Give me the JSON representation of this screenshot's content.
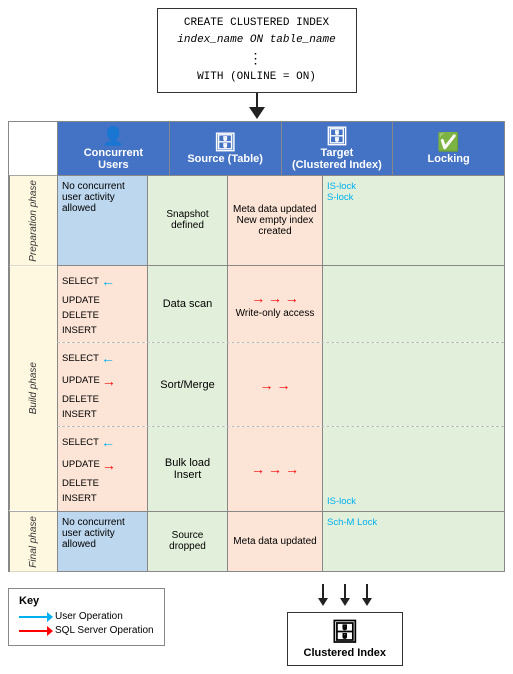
{
  "top": {
    "line1": "CREATE CLUSTERED INDEX",
    "line2": "index_name ON table_name",
    "dots": "⋮",
    "line3": "WITH (ONLINE = ON)"
  },
  "headers": {
    "concurrent": "Concurrent\nUsers",
    "source": "Source (Table)",
    "target": "Target\n(Clustered Index)",
    "locking": "Locking"
  },
  "phases": {
    "preparation": {
      "label": "Preparation phase",
      "concurrent": "No concurrent user activity allowed",
      "source": "Snapshot defined",
      "target": "Meta data updated New empty index created",
      "locking_is": "IS-lock",
      "locking_s": "S-lock"
    },
    "build": {
      "label": "Build phase",
      "sub1": {
        "ops": [
          "SELECT",
          "UPDATE",
          "DELETE",
          "INSERT"
        ],
        "source": "Data scan",
        "target": "Write-only access",
        "locking": ""
      },
      "sub2": {
        "ops": [
          "SELECT",
          "UPDATE",
          "DELETE",
          "INSERT"
        ],
        "source": "Sort/Merge",
        "target": "",
        "locking": ""
      },
      "sub3": {
        "ops": [
          "SELECT",
          "UPDATE",
          "DELETE",
          "INSERT"
        ],
        "source": "Bulk load\nInsert",
        "target": "",
        "locking": "IS-lock"
      }
    },
    "final": {
      "label": "Final phase",
      "concurrent": "No concurrent user activity allowed",
      "source": "Source dropped",
      "target": "Meta data updated",
      "locking": "Sch-M Lock"
    }
  },
  "key": {
    "title": "Key",
    "user_op": "User Operation",
    "sql_op": "SQL Server Operation"
  },
  "bottom": {
    "icon": "🗄",
    "label": "Clustered Index"
  }
}
